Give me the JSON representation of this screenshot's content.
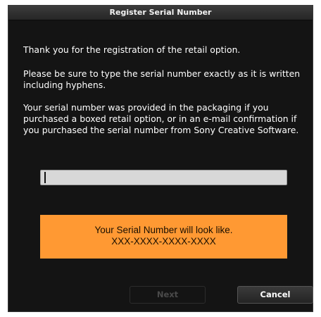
{
  "window": {
    "title": "Register Serial Number"
  },
  "messages": {
    "thanks": "Thank you for the registration of the retail option.",
    "instructions": "Please be sure to type the serial number exactly as it is written including hyphens.",
    "provided": "Your serial number was provided in the packaging if you purchased a boxed retail option, or in an e-mail confirmation if you purchased the serial number from Sony Creative Software."
  },
  "serial_input": {
    "value": ""
  },
  "hint": {
    "line1": "Your Serial Number will look like.",
    "line2": "XXX-XXXX-XXXX-XXXX"
  },
  "buttons": {
    "next_label": "Next",
    "cancel_label": "Cancel"
  },
  "colors": {
    "background": "#141414",
    "hint_box": "#ff9933"
  }
}
